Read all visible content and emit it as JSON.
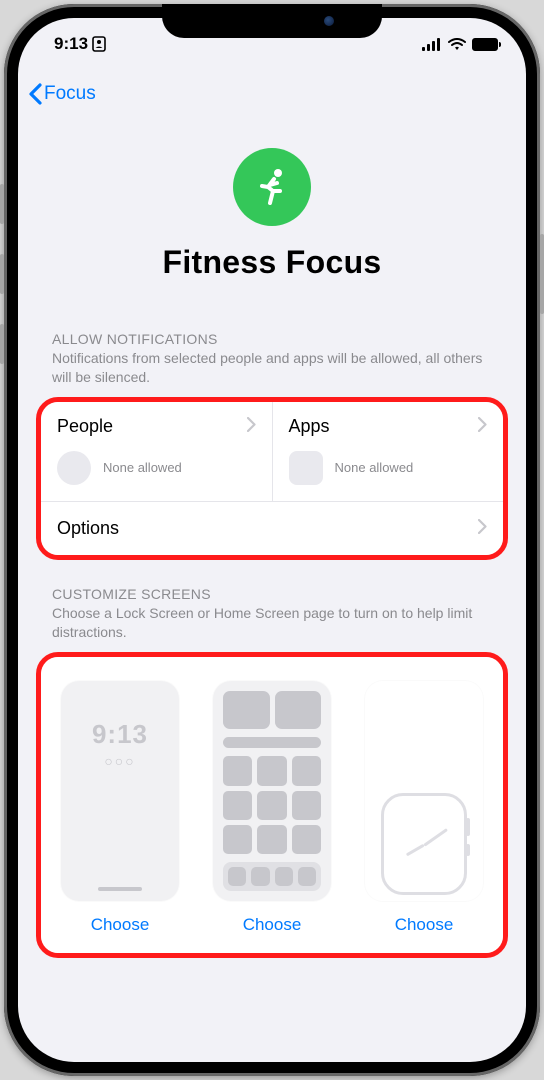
{
  "status": {
    "time": "9:13",
    "card_icon": true
  },
  "nav": {
    "back_label": "Focus"
  },
  "header": {
    "title": "Fitness Focus",
    "icon_color": "#34c759"
  },
  "notifications": {
    "section_title": "ALLOW NOTIFICATIONS",
    "section_subtitle": "Notifications from selected people and apps will be allowed, all others will be silenced.",
    "people": {
      "label": "People",
      "status": "None allowed"
    },
    "apps": {
      "label": "Apps",
      "status": "None allowed"
    },
    "options_label": "Options"
  },
  "customize": {
    "section_title": "CUSTOMIZE SCREENS",
    "section_subtitle": "Choose a Lock Screen or Home Screen page to turn on to help limit distractions.",
    "lock_time": "9:13",
    "choose_label": "Choose"
  },
  "colors": {
    "link": "#007aff",
    "highlight": "#ff1b1b"
  }
}
